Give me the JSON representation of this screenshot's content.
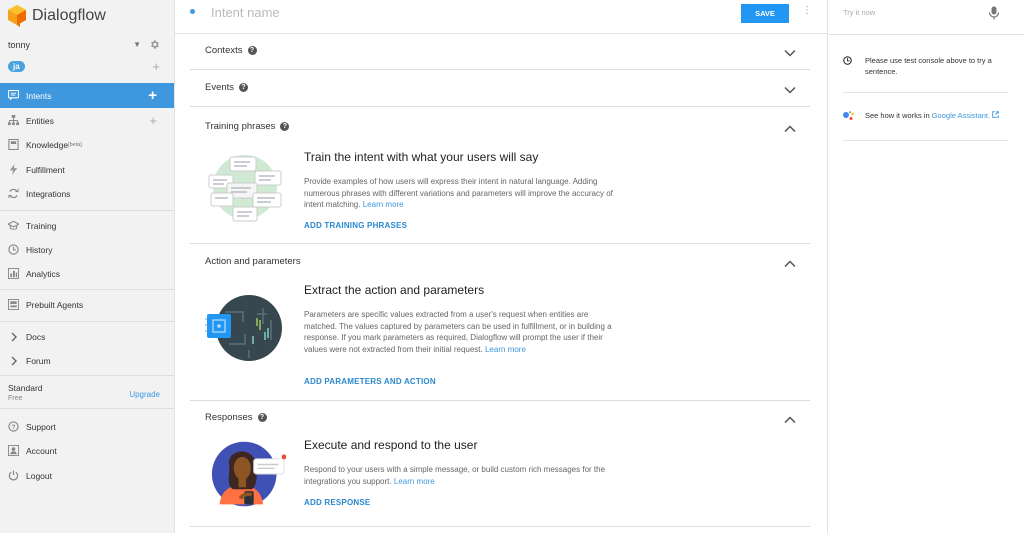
{
  "app": {
    "name": "Dialogflow"
  },
  "colors": {
    "accent": "#3f98de",
    "save": "#2196f3",
    "logo": "#f6a11a"
  },
  "agent": {
    "name": "tonny",
    "language": "ja"
  },
  "nav": {
    "intents": "Intents",
    "entities": "Entities",
    "knowledge": "Knowledge",
    "knowledge_badge": "[beta]",
    "fulfillment": "Fulfillment",
    "integrations": "Integrations",
    "training": "Training",
    "history": "History",
    "analytics": "Analytics",
    "prebuilt": "Prebuilt Agents",
    "docs": "Docs",
    "forum": "Forum",
    "support": "Support",
    "account": "Account",
    "logout": "Logout"
  },
  "plan": {
    "name": "Standard",
    "tier": "Free",
    "upgrade": "Upgrade"
  },
  "header": {
    "intent_placeholder": "Intent name",
    "save": "SAVE"
  },
  "sections": {
    "contexts": "Contexts",
    "events": "Events",
    "training": {
      "title": "Training phrases",
      "heading": "Train the intent with what your users will say",
      "body": "Provide examples of how users will express their intent in natural language. Adding numerous phrases with different variations and parameters will improve the accuracy of intent matching.",
      "link": "Learn more",
      "action": "ADD TRAINING PHRASES"
    },
    "action": {
      "title": "Action and parameters",
      "heading": "Extract the action and parameters",
      "body": "Parameters are specific values extracted from a user's request when entities are matched. The values captured by parameters can be used in fulfillment, or in building a response. If you mark parameters as required, Dialogflow will prompt the user if their values were not extracted from their initial request.",
      "link": "Learn more",
      "action": "ADD PARAMETERS AND ACTION"
    },
    "responses": {
      "title": "Responses",
      "heading": "Execute and respond to the user",
      "body": "Respond to your users with a simple message, or build custom rich messages for the integrations you support.",
      "link": "Learn more",
      "action": "ADD RESPONSE"
    }
  },
  "right_panel": {
    "try_placeholder": "Try it now",
    "notice": "Please use test console above to try a sentence.",
    "assistant_text": "See how it works in",
    "assistant_link": "Google Assistant."
  }
}
